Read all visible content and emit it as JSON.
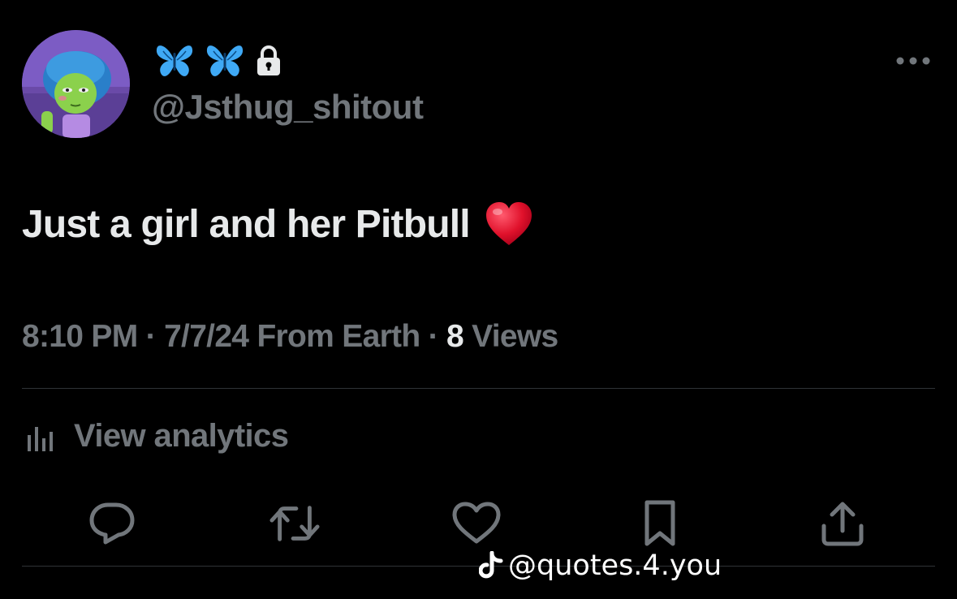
{
  "tweet": {
    "display_name_emojis": [
      "butterfly-emoji",
      "butterfly-emoji"
    ],
    "protected_icon": "lock-icon",
    "handle": "@Jsthug_shitout",
    "text": "Just a girl and her Pitbull",
    "text_emoji": "red-heart-emoji",
    "meta": {
      "time": "8:10 PM",
      "separator": " · ",
      "date": "7/7/24",
      "source": "From Earth",
      "views_count": "8",
      "views_label": "Views"
    },
    "analytics_label": "View analytics",
    "actions": [
      "reply-icon",
      "retweet-icon",
      "like-icon",
      "bookmark-icon",
      "share-icon"
    ]
  },
  "watermark": {
    "logo": "tiktok-icon",
    "text": "@quotes.4.you"
  },
  "colors": {
    "background": "#000000",
    "primary_text": "#e7e9ea",
    "secondary_text": "#71767b",
    "divider": "#2f3336",
    "butterfly": "#3fa9f5",
    "heart": "#e0112b"
  }
}
